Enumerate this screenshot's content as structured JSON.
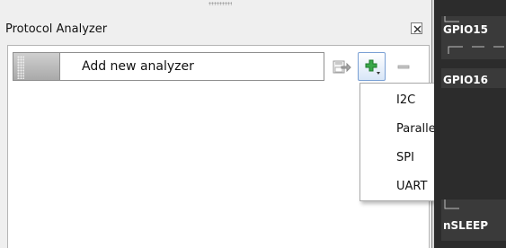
{
  "panel": {
    "title": "Protocol Analyzer",
    "close_icon": "close-box-icon"
  },
  "toolbar": {
    "input_value": "Add new analyzer",
    "icons": {
      "save": "export-icon",
      "add": "green-plus-dropdown-icon",
      "remove": "minus-icon"
    }
  },
  "menu": {
    "items": [
      "I2C",
      "Parallel",
      "SPI",
      "UART"
    ]
  },
  "right_pane": {
    "labels": [
      "GPIO15",
      "GPIO16",
      "nSLEEP"
    ]
  },
  "colors": {
    "panel_bg": "#efefef",
    "signal_bg": "#2c2c2c",
    "add_green": "#3aa84a"
  }
}
